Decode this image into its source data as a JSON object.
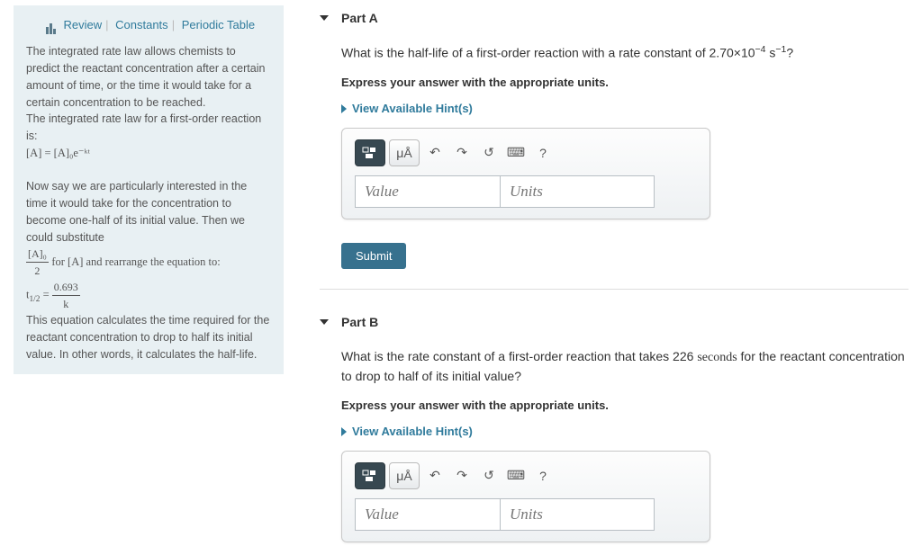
{
  "sidebar": {
    "links": {
      "review": "Review",
      "constants": "Constants",
      "periodic": "Periodic Table"
    },
    "p1": "The integrated rate law allows chemists to predict the reactant concentration after a certain amount of time, or the time it would take for a certain concentration to be reached.",
    "p2": "The integrated rate law for a first-order reaction is:",
    "eq1": "[A] = [A]₀e⁻ᵏᵗ",
    "p3": "Now say we are particularly interested in the time it would take for the concentration to become one-half of its initial value. Then we could substitute",
    "eq2a": "[A]₀",
    "eq2a_d": "2",
    "eq2b": " for [A] and rearrange the equation to:",
    "eq3a": "t",
    "eq3b": "1/2",
    "eq3c": " = ",
    "eq3n": "0.693",
    "eq3d": "k",
    "p4": " This equation calculates the time required for the reactant concentration to drop to half its initial value. In other words, it calculates the half-life."
  },
  "partA": {
    "title": "Part A",
    "q1": "What is the half-life of a first-order reaction with a rate constant of 2.70×10",
    "q_exp": "−4",
    "q_unit": " s",
    "q_unit_exp": "−1",
    "q_end": "?",
    "instruct": "Express your answer with the appropriate units.",
    "hints": "View Available Hint(s)",
    "value_ph": "Value",
    "units_ph": "Units",
    "tb": {
      "units": "μÅ",
      "undo": "↶",
      "redo": "↷",
      "reset": "↺",
      "keyboard": "⌨",
      "help": "?"
    },
    "submit": "Submit"
  },
  "partB": {
    "title": "Part B",
    "q1": "What is the rate constant of a first-order reaction that takes 226 ",
    "q_sec": "seconds",
    "q2": " for the reactant concentration to drop to half of its initial value?",
    "instruct": "Express your answer with the appropriate units.",
    "hints": "View Available Hint(s)",
    "value_ph": "Value",
    "units_ph": "Units",
    "tb": {
      "units": "μÅ",
      "undo": "↶",
      "redo": "↷",
      "reset": "↺",
      "keyboard": "⌨",
      "help": "?"
    }
  }
}
